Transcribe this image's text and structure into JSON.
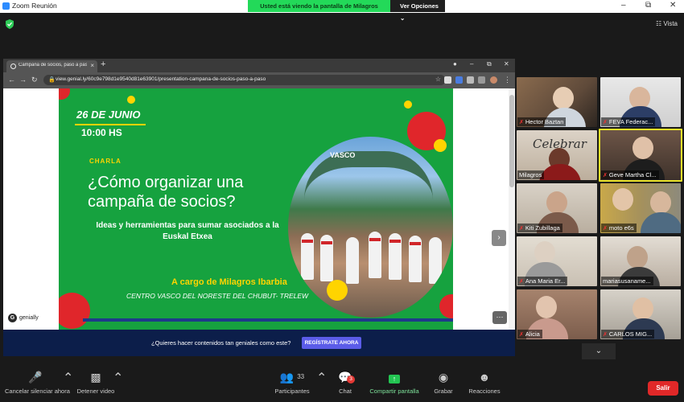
{
  "window": {
    "title": "Zoom Reunión",
    "app_icon": "zoom-camera-icon"
  },
  "share_banner": {
    "message": "Usted está viendo la pantalla de Milagros",
    "view_options": "Ver Opciones"
  },
  "top_right": {
    "view_label": "Vista"
  },
  "browser": {
    "tab_title": "Campaña de socios, paso a paso",
    "url": "view.genial.ly/60c9e798d1e9540d81e63901/presentation-campana-de-socios-paso-a-paso"
  },
  "slide": {
    "date": "26 DE JUNIO",
    "time": "10:00 HS",
    "charla": "CHARLA",
    "headline": "¿Cómo organizar una campaña de socios?",
    "subhead": "Ideas y herramientas para sumar asociados a la Euskal Etxea",
    "speaker": "A cargo de Milagros Ibarbia",
    "organization": "CENTRO VASCO DEL NORESTE DEL CHUBUT- TRELEW",
    "photo_sign": "VASCO",
    "colors": {
      "green": "#16a23f",
      "yellow": "#ffd400",
      "red": "#e0262b",
      "navy": "#1e3a8a"
    }
  },
  "genially": {
    "brand": "genially"
  },
  "cta": {
    "text": "¿Quieres hacer contenidos tan geniales como este?",
    "button": "REGÍSTRATE AHORA"
  },
  "participants": [
    {
      "name": "Hector Baztan",
      "muted": true
    },
    {
      "name": "FEVA Federac...",
      "muted": true
    },
    {
      "name": "Milagros",
      "muted": false
    },
    {
      "name": "Geve Martha Cl...",
      "muted": true,
      "active_speaker": true
    },
    {
      "name": "Kiti Zubillaga",
      "muted": true
    },
    {
      "name": "moto e6s",
      "muted": true
    },
    {
      "name": "Ana Maria Er...",
      "muted": true
    },
    {
      "name": "mariasusaname...",
      "muted": false
    },
    {
      "name": "Alicia",
      "muted": true
    },
    {
      "name": "CARLOS MIG...",
      "muted": true
    }
  ],
  "toolbar": {
    "unmute": "Cancelar silenciar ahora",
    "stop_video": "Detener video",
    "participants": "Participantes",
    "participants_count": "33",
    "chat": "Chat",
    "chat_badge": "3",
    "share_screen": "Compartir pantalla",
    "record": "Grabar",
    "reactions": "Reacciones",
    "leave": "Salir"
  }
}
